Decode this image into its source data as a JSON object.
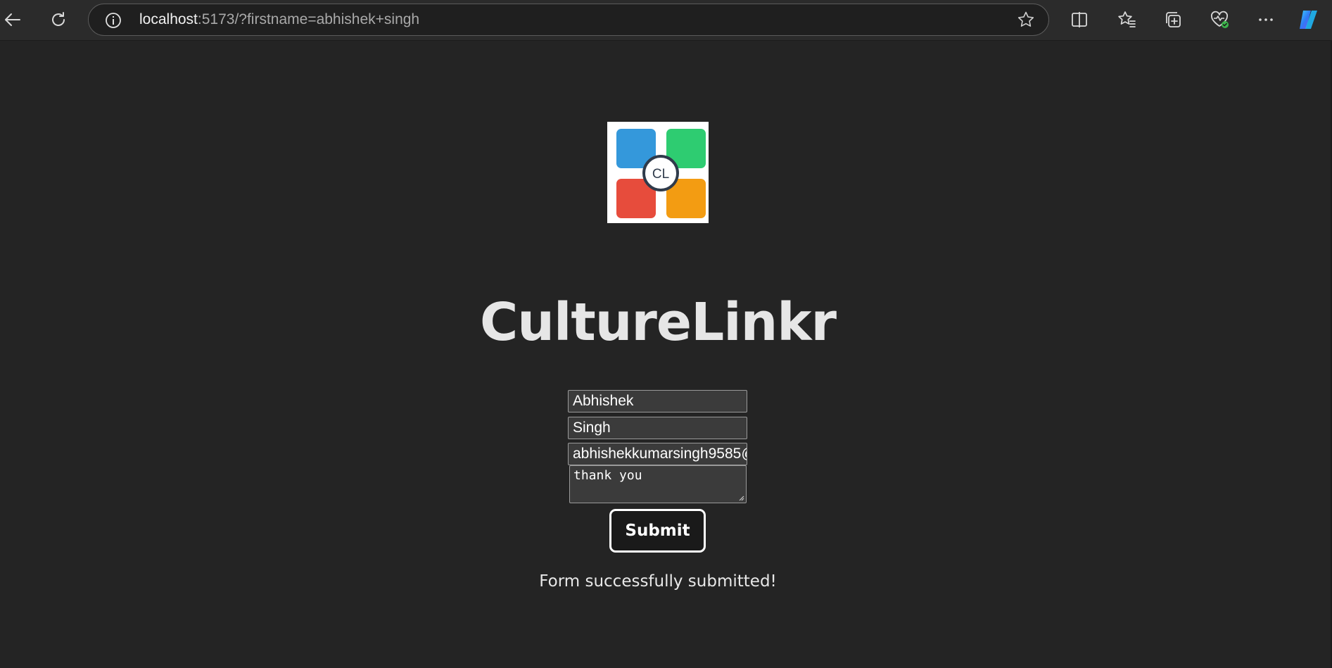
{
  "browser": {
    "url_host": "localhost",
    "url_rest": ":5173/?firstname=abhishek+singh",
    "icons": [
      "back-icon",
      "refresh-icon",
      "site-info-icon",
      "favorite-star-icon",
      "split-screen-icon",
      "favorites-icon",
      "collections-icon",
      "browser-essentials-icon",
      "more-icon",
      "copilot-icon"
    ]
  },
  "page": {
    "logo_text": "CL",
    "logo_colors": [
      "#3498db",
      "#2ecc71",
      "#e74c3c",
      "#f39c12"
    ],
    "title": "CultureLinkr",
    "form": {
      "first_name": "Abhishek",
      "last_name": "Singh",
      "email": "abhishekkumarsingh9585@",
      "message": "thank you",
      "submit_label": "Submit"
    },
    "status_message": "Form successfully submitted!"
  }
}
